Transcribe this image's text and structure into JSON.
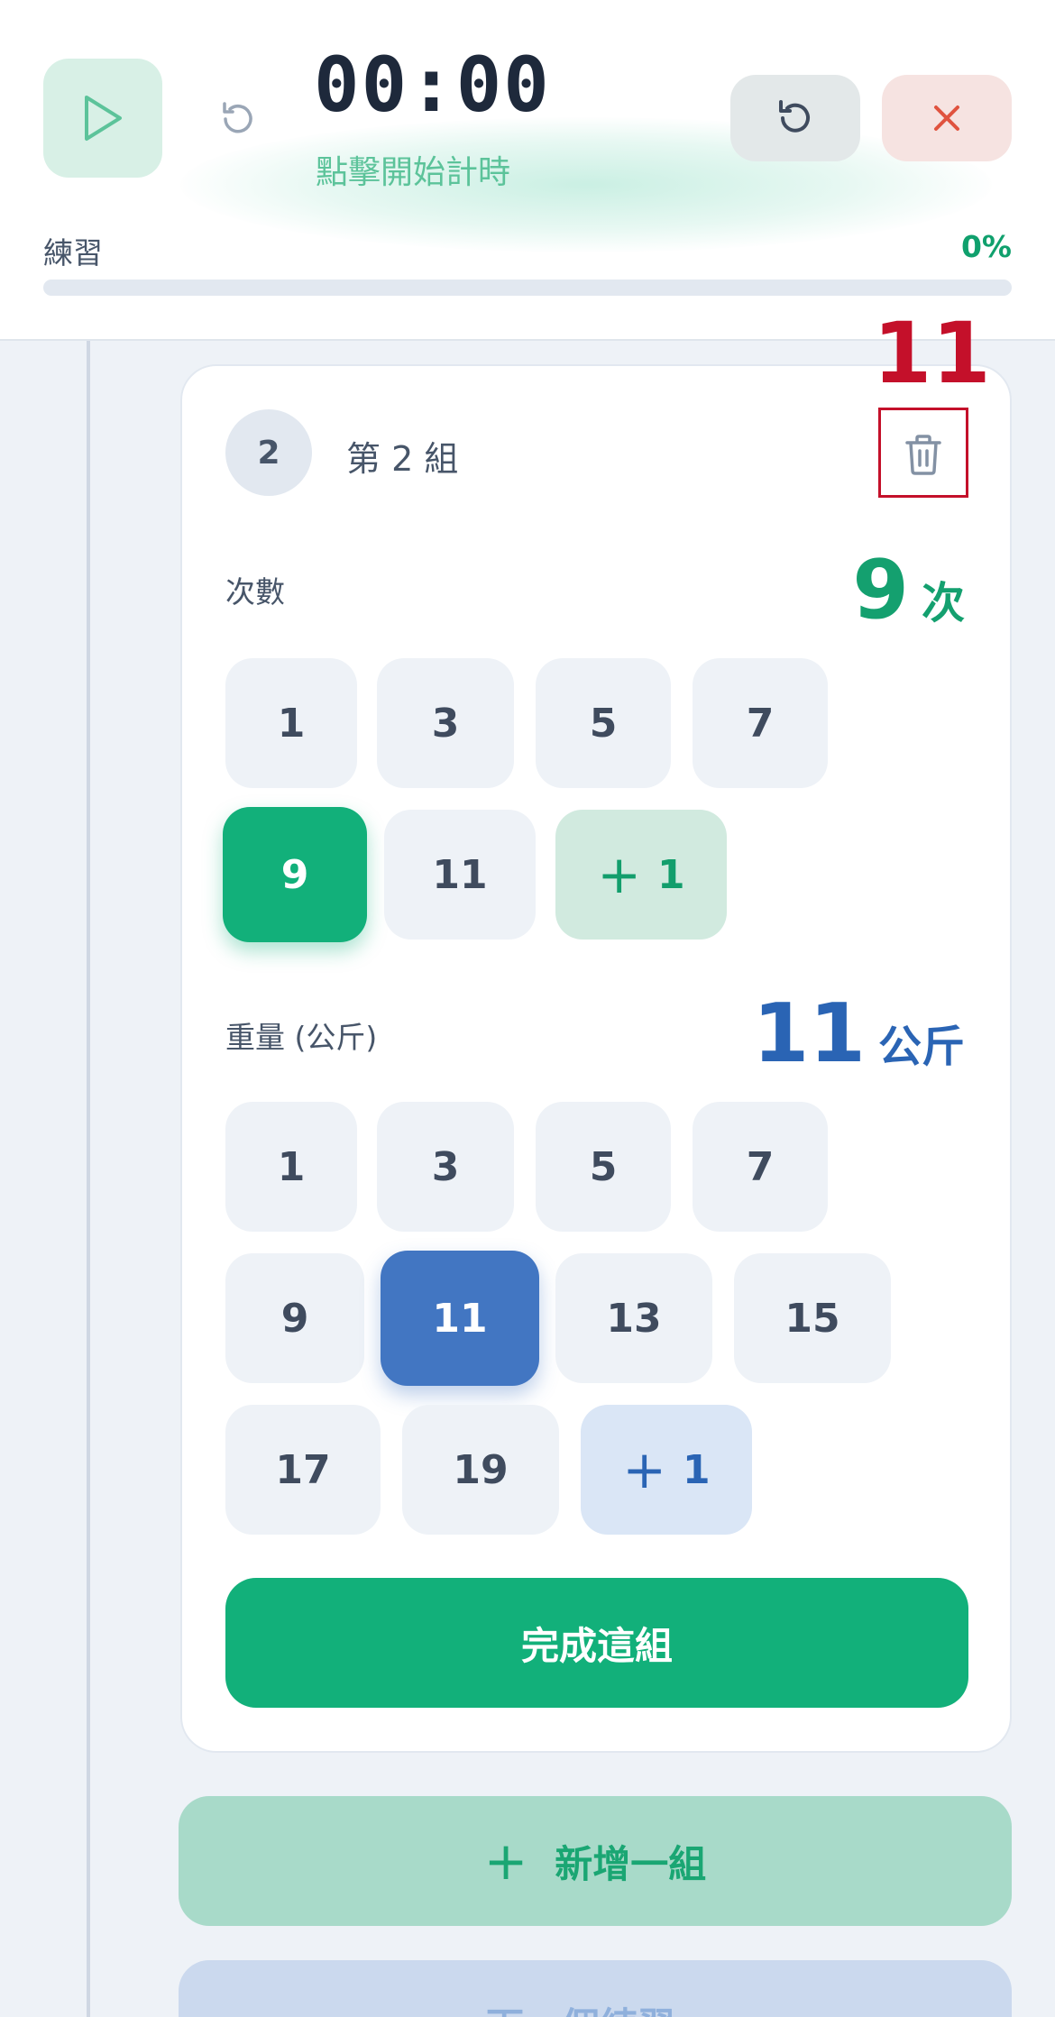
{
  "timer": {
    "display": "00:00",
    "hint": "點擊開始計時"
  },
  "progress": {
    "label": "練習",
    "percent_text": "0%",
    "value": 0
  },
  "set": {
    "number": "2",
    "title": "第 2 組",
    "reps": {
      "label": "次數",
      "value": "9",
      "unit": "次",
      "options": [
        "1",
        "3",
        "5",
        "7",
        "9",
        "11"
      ],
      "selected": "9",
      "increment_label": "1"
    },
    "weight": {
      "label": "重量 (公斤)",
      "value": "11",
      "unit": "公斤",
      "options": [
        "1",
        "3",
        "5",
        "7",
        "9",
        "11",
        "13",
        "15",
        "17",
        "19"
      ],
      "selected": "11",
      "increment_label": "1"
    },
    "complete_label": "完成這組"
  },
  "actions": {
    "add_set_label": "新增一組",
    "next_exercise_label": "下一個練習 ›"
  },
  "annotation": {
    "label": "11"
  },
  "colors": {
    "accent_green": "#12b07a",
    "accent_blue": "#4276c2",
    "danger_red": "#e0533f",
    "annotation_red": "#c4102a"
  },
  "icons": {
    "play": "play-icon",
    "undo": "undo-icon",
    "reset": "reset-icon",
    "close": "close-icon",
    "trash": "trash-icon",
    "plus": "plus-icon"
  }
}
